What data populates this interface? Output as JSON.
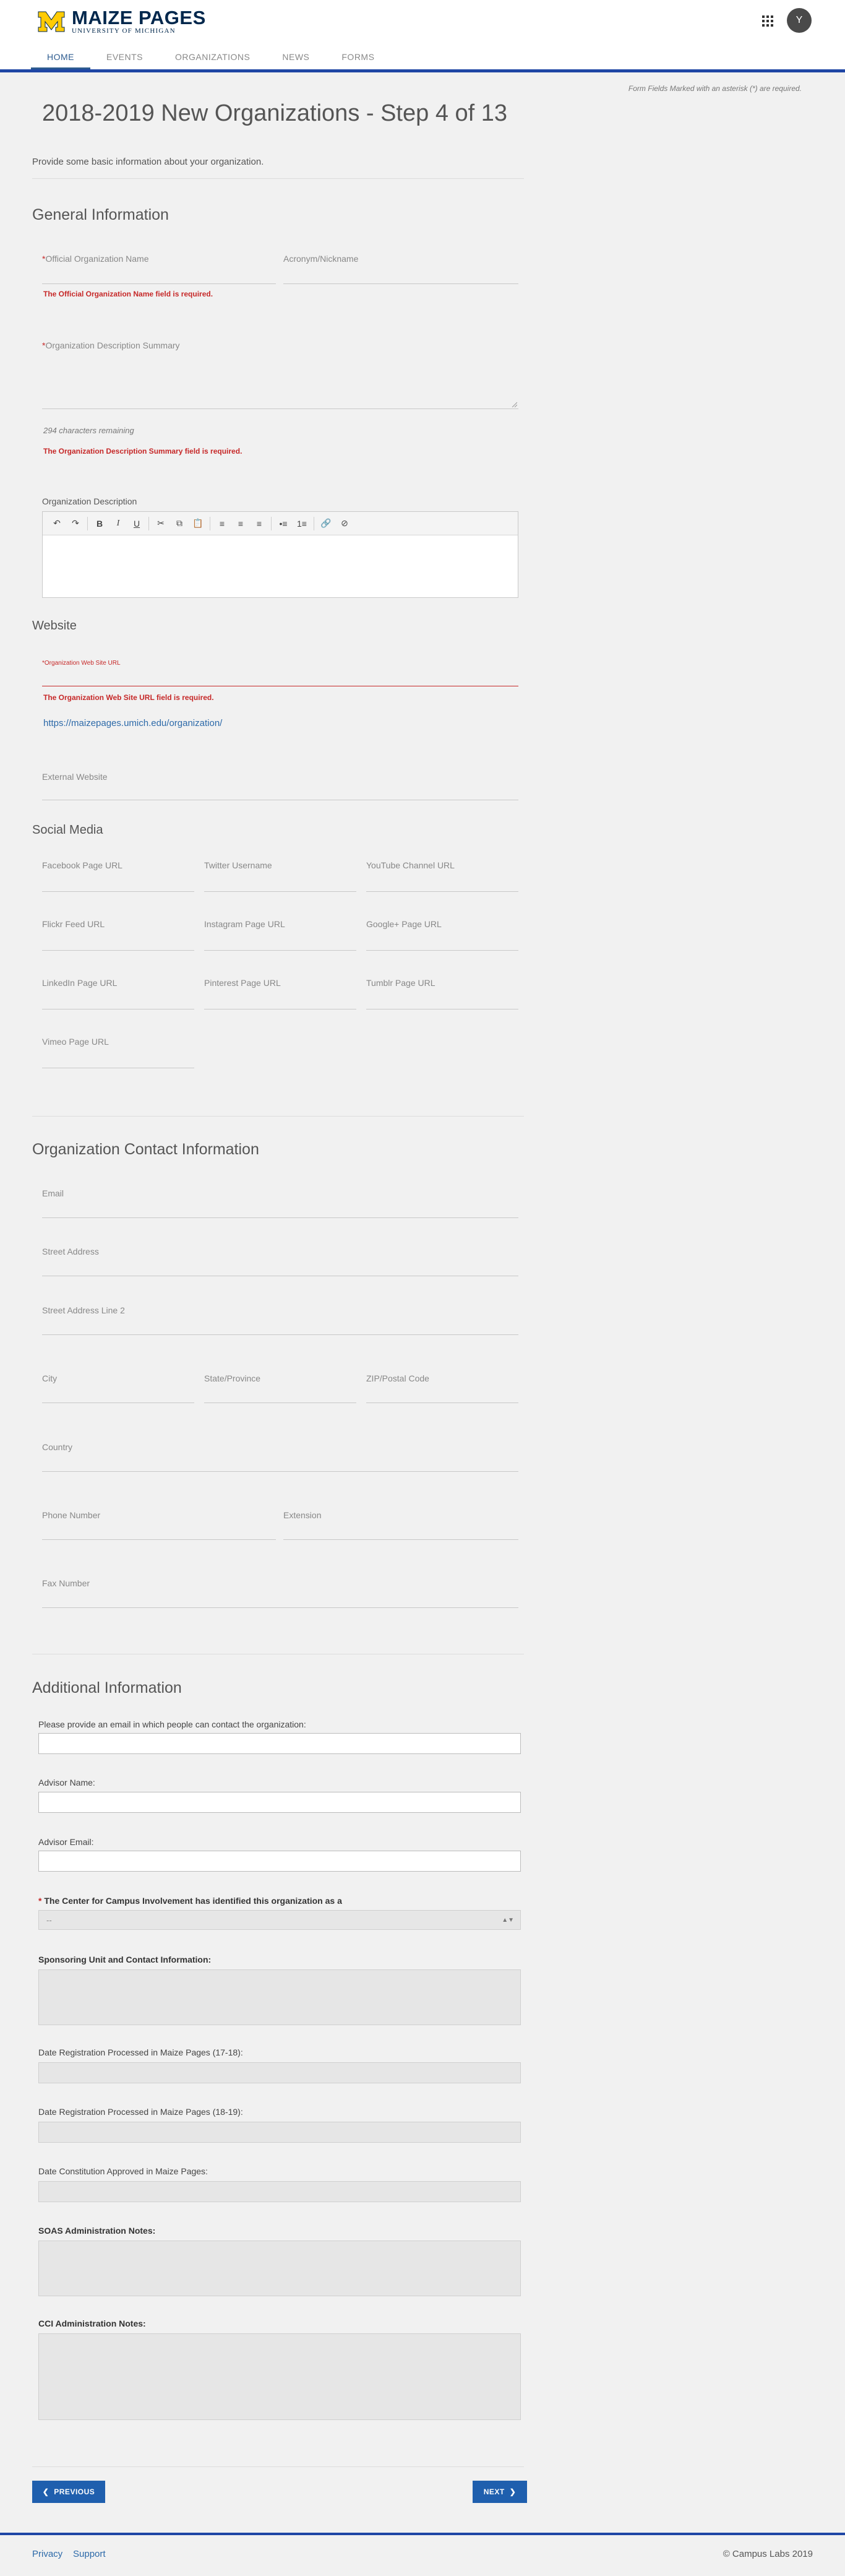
{
  "header": {
    "logo_title": "MAIZE PAGES",
    "logo_subtitle": "UNIVERSITY OF MICHIGAN",
    "avatar_initial": "Y",
    "nav": [
      "HOME",
      "EVENTS",
      "ORGANIZATIONS",
      "NEWS",
      "FORMS"
    ],
    "active_tab": "HOME"
  },
  "required_note": "Form Fields Marked with an asterisk (*) are required.",
  "page_title": "2018-2019 New Organizations - Step 4 of 13",
  "intro": "Provide some basic information about your organization.",
  "general": {
    "heading": "General Information",
    "official_name_label": "Official Organization Name",
    "acronym_label": "Acronym/Nickname",
    "official_name_error": "The Official Organization Name field is required.",
    "summary_label": "Organization Description Summary",
    "chars_remaining": "294 characters remaining",
    "summary_error": "The Organization Description Summary field is required.",
    "description_label": "Organization Description"
  },
  "website": {
    "heading": "Website",
    "url_label": "Organization Web Site URL",
    "url_error": "The Organization Web Site URL field is required.",
    "url_prefix": "https://maizepages.umich.edu/organization/",
    "external_label": "External Website"
  },
  "social": {
    "heading": "Social Media",
    "fields": [
      "Facebook Page URL",
      "Twitter Username",
      "YouTube Channel URL",
      "Flickr Feed URL",
      "Instagram Page URL",
      "Google+ Page URL",
      "LinkedIn Page URL",
      "Pinterest Page URL",
      "Tumblr Page URL",
      "Vimeo Page URL"
    ]
  },
  "contact": {
    "heading": "Organization Contact Information",
    "email": "Email",
    "street": "Street Address",
    "street2": "Street Address Line 2",
    "city": "City",
    "state": "State/Province",
    "zip": "ZIP/Postal Code",
    "country": "Country",
    "phone": "Phone Number",
    "extension": "Extension",
    "fax": "Fax Number"
  },
  "additional": {
    "heading": "Additional Information",
    "contact_email_q": "Please provide an email in which people can contact the organization:",
    "advisor_name": "Advisor Name:",
    "advisor_email": "Advisor Email:",
    "cci_label": "The Center for Campus Involvement has identified this organization as a",
    "cci_selected": "--",
    "sponsoring_label": "Sponsoring Unit and Contact Information:",
    "date_1718": "Date Registration Processed in Maize Pages (17-18):",
    "date_1819": "Date Registration Processed in Maize Pages (18-19):",
    "date_constitution": "Date Constitution Approved in Maize Pages:",
    "soas_notes": "SOAS Administration Notes:",
    "cci_notes": "CCI Administration Notes:"
  },
  "buttons": {
    "previous": "PREVIOUS",
    "next": "NEXT"
  },
  "footer": {
    "privacy": "Privacy",
    "support": "Support",
    "copyright": "© Campus Labs 2019"
  },
  "colors": {
    "brand_navy": "#00274c",
    "maize": "#ffcb05",
    "accent_blue": "#1f46a5",
    "error_red": "#c62828",
    "button_blue": "#1f5fae"
  }
}
